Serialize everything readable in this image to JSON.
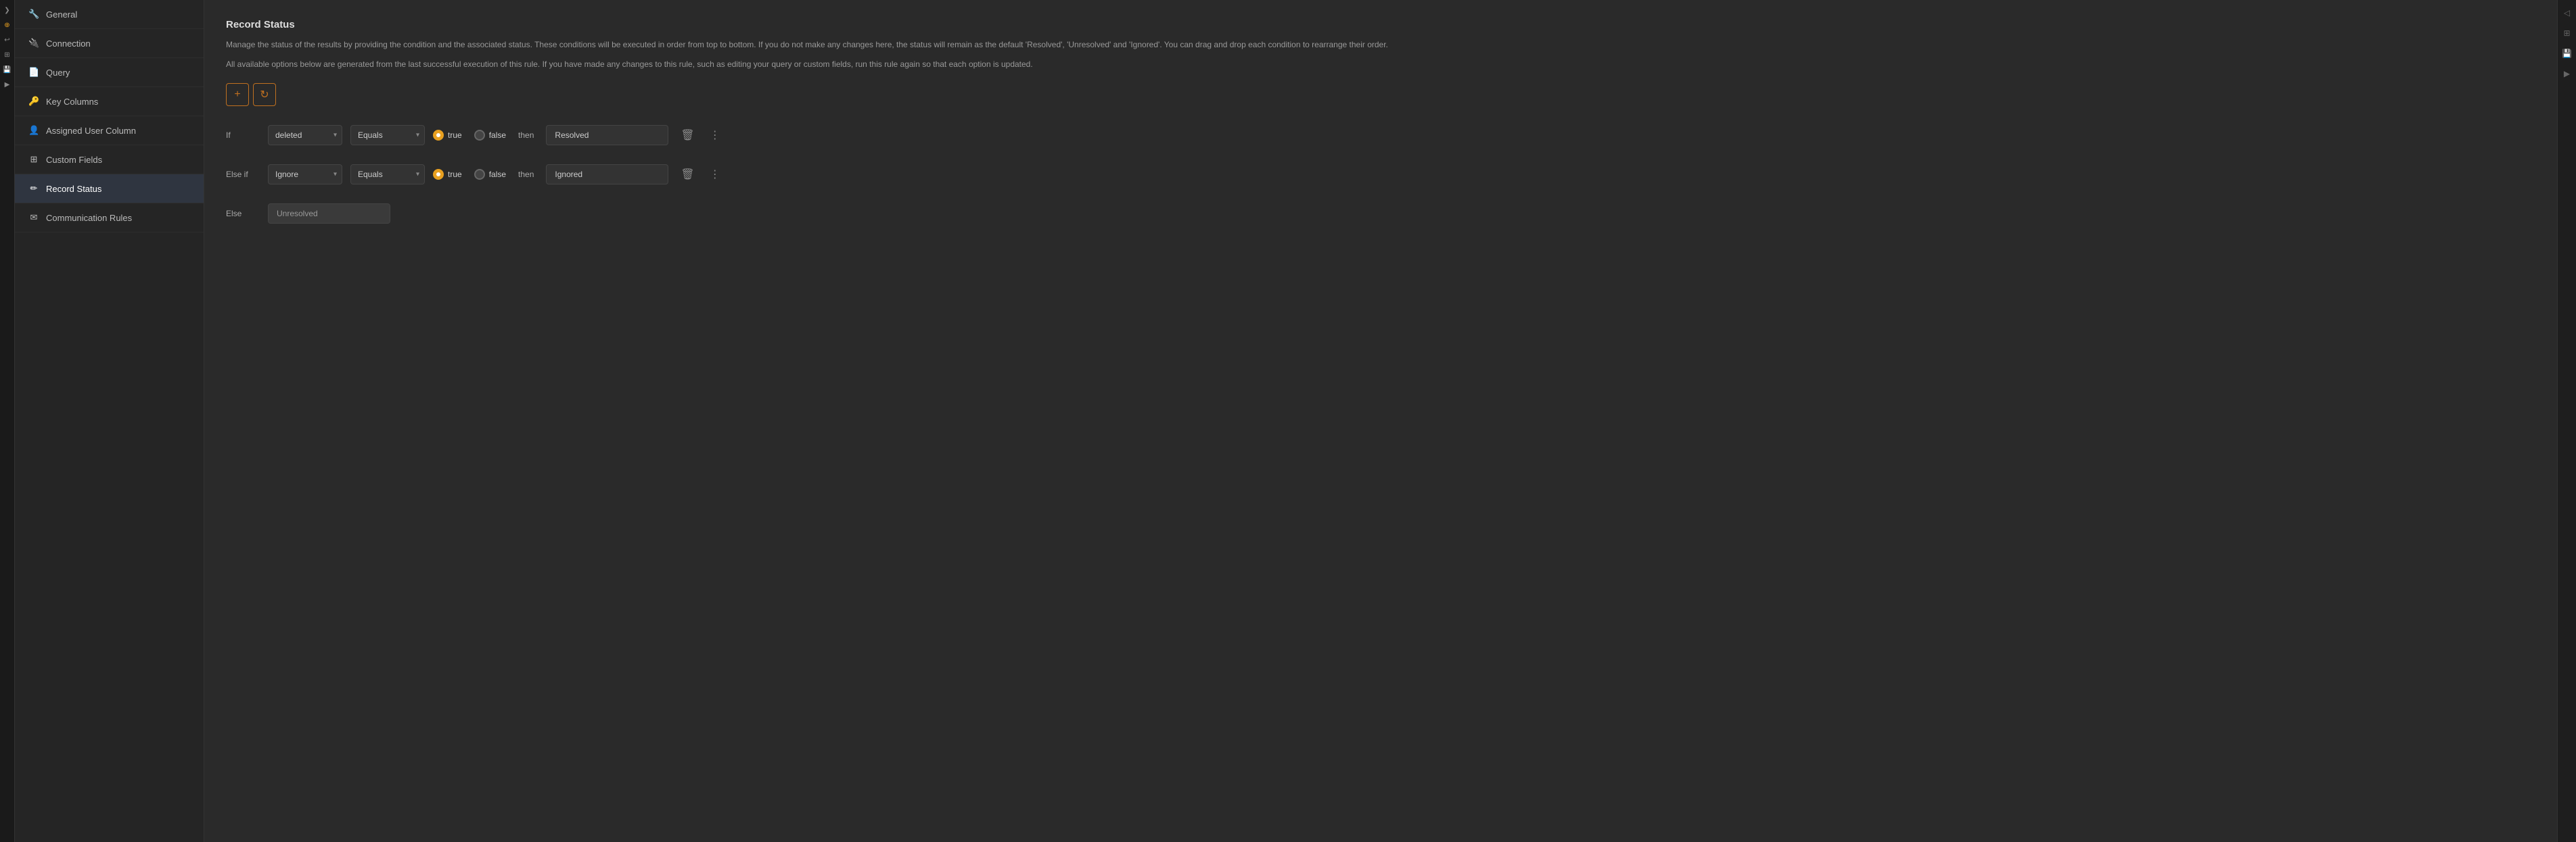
{
  "iconBar": {
    "items": [
      {
        "icon": "❯❯",
        "label": "expand-icon",
        "active": false
      },
      {
        "icon": "⊕",
        "label": "add-icon",
        "active": true
      },
      {
        "icon": "↩",
        "label": "undo-icon",
        "active": false
      },
      {
        "icon": "⊞",
        "label": "grid-icon",
        "active": false
      },
      {
        "icon": "💾",
        "label": "save-icon",
        "active": false
      },
      {
        "icon": "▶",
        "label": "run-icon",
        "active": false
      }
    ]
  },
  "sidebar": {
    "items": [
      {
        "id": "general",
        "icon": "🔧",
        "label": "General",
        "active": false
      },
      {
        "id": "connection",
        "icon": "🔌",
        "label": "Connection",
        "active": false
      },
      {
        "id": "query",
        "icon": "📄",
        "label": "Query",
        "active": false
      },
      {
        "id": "key-columns",
        "icon": "🔑",
        "label": "Key Columns",
        "active": false
      },
      {
        "id": "assigned-user",
        "icon": "👤",
        "label": "Assigned User Column",
        "active": false
      },
      {
        "id": "custom-fields",
        "icon": "⊞",
        "label": "Custom Fields",
        "active": false
      },
      {
        "id": "record-status",
        "icon": "✏",
        "label": "Record Status",
        "active": true
      },
      {
        "id": "communication-rules",
        "icon": "✉",
        "label": "Communication Rules",
        "active": false
      }
    ]
  },
  "main": {
    "title": "Record Status",
    "description1": "Manage the status of the results by providing the condition and the associated status. These conditions will be executed in order from top to bottom. If you do not make any changes here, the status will remain as the default 'Resolved', 'Unresolved' and 'Ignored'. You can drag and drop each condition to rearrange their order.",
    "description2": "All available options below are generated from the last successful execution of this rule. If you have made any changes to this rule, such as editing your query or custom fields, run this rule again so that each option is updated.",
    "addButtonLabel": "+",
    "refreshButtonLabel": "↻",
    "conditions": [
      {
        "type": "If",
        "field": "deleted",
        "operator": "Equals",
        "trueLabel": "true",
        "falseLabel": "false",
        "trueSelected": true,
        "thenLabel": "then",
        "result": "Resolved"
      },
      {
        "type": "Else if",
        "field": "Ignore",
        "operator": "Equals",
        "trueLabel": "true",
        "falseLabel": "false",
        "trueSelected": true,
        "thenLabel": "then",
        "result": "Ignored"
      }
    ],
    "elseLabel": "Else",
    "elseValue": "Unresolved"
  },
  "rightRail": {
    "items": [
      {
        "icon": "◁◁",
        "label": "collapse-icon"
      },
      {
        "icon": "⊞",
        "label": "grid-right-icon"
      },
      {
        "icon": "💾",
        "label": "save-right-icon"
      },
      {
        "icon": "▶",
        "label": "play-right-icon"
      }
    ]
  }
}
